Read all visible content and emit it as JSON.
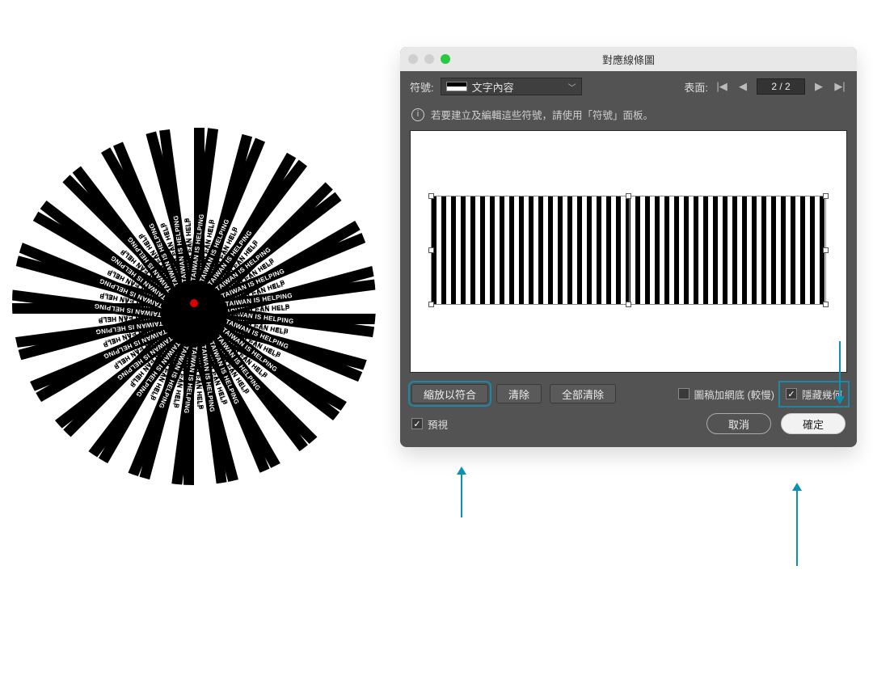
{
  "artwork": {
    "text_a": "TAIWAN CAN HELP",
    "text_b": "TAIWAN IS HELPING"
  },
  "dialog": {
    "title": "對應線條圖",
    "symbol_label": "符號:",
    "symbol_value": "文字內容",
    "surface_label": "表面:",
    "page_value": "2 / 2",
    "hint": "若要建立及編輯這些符號，請使用「符號」面板。",
    "buttons": {
      "fit": "縮放以符合",
      "clear": "清除",
      "clear_all": "全部清除"
    },
    "checkboxes": {
      "shade": {
        "label": "圖稿加網底 (較慢)",
        "checked": false
      },
      "hide_geo": {
        "label": "隱藏幾何",
        "checked": true
      }
    },
    "preview_label": "預視",
    "preview_checked": true,
    "cancel": "取消",
    "ok": "確定"
  }
}
